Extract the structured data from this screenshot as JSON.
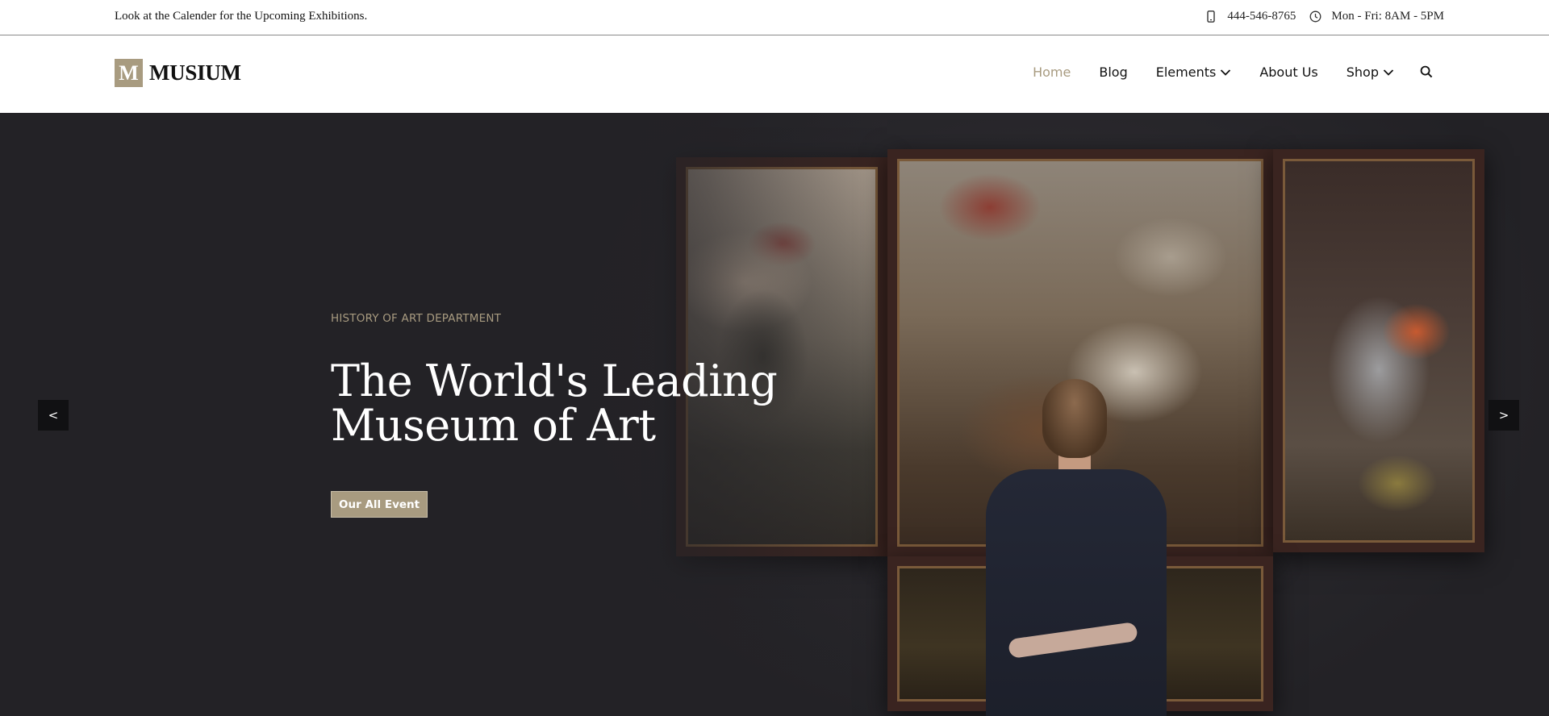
{
  "topbar": {
    "note": "Look at the Calender for the Upcoming Exhibitions.",
    "phone_icon": "phone-icon",
    "phone": "444-546-8765",
    "clock_icon": "clock-icon",
    "hours": "Mon - Fri: 8AM - 5PM"
  },
  "brand": {
    "mark": "M",
    "name": "MUSIUM",
    "mark_color": "#a89b80"
  },
  "nav": {
    "items": [
      {
        "label": "Home",
        "active": true
      },
      {
        "label": "Blog"
      },
      {
        "label": "Elements",
        "dropdown": true
      },
      {
        "label": "About Us"
      },
      {
        "label": "Shop",
        "dropdown": true
      }
    ],
    "search_icon": "search-icon",
    "active_color": "#a89b80"
  },
  "hero": {
    "kicker": "HISTORY OF ART DEPARTMENT",
    "headline_line1": "The World's Leading",
    "headline_line2": "Museum of Art",
    "cta_label": "Our All Event",
    "prev_label": "<",
    "next_label": ">",
    "background_color": "#232226",
    "accent_color": "#a89b80"
  }
}
